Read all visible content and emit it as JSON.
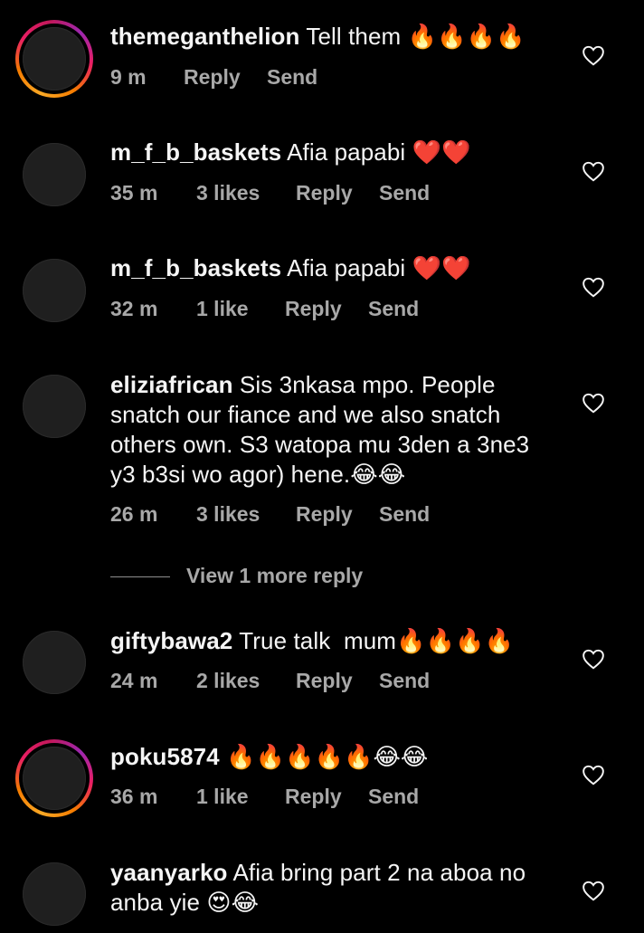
{
  "comments": [
    {
      "username": "themeganthelion",
      "text": "Tell them 🔥🔥🔥🔥",
      "time": "9 m",
      "likes": "",
      "reply": "Reply",
      "send": "Send",
      "story_ring": true
    },
    {
      "username": "m_f_b_baskets",
      "text": "Afia papabi ❤️❤️",
      "time": "35 m",
      "likes": "3 likes",
      "reply": "Reply",
      "send": "Send",
      "story_ring": false
    },
    {
      "username": "m_f_b_baskets",
      "text": "Afia papabi ❤️❤️",
      "time": "32 m",
      "likes": "1 like",
      "reply": "Reply",
      "send": "Send",
      "story_ring": false
    },
    {
      "username": "eliziafrican",
      "text": "Sis 3nkasa mpo. People snatch our fiance and we also snatch others own. S3 watopa mu 3den a 3ne3 y3 b3si wo agor) hene.😂😂",
      "time": "26 m",
      "likes": "3 likes",
      "reply": "Reply",
      "send": "Send",
      "story_ring": false
    },
    {
      "username": "giftybawa2",
      "text": "True talk  mum🔥🔥🔥🔥",
      "time": "24 m",
      "likes": "2 likes",
      "reply": "Reply",
      "send": "Send",
      "story_ring": false
    },
    {
      "username": "poku5874",
      "text": "🔥🔥🔥🔥🔥😂😂",
      "time": "36 m",
      "likes": "1 like",
      "reply": "Reply",
      "send": "Send",
      "story_ring": true
    },
    {
      "username": "yaanyarko",
      "text": "Afia bring part 2 na aboa no anba yie 😍😂",
      "time": "",
      "likes": "",
      "reply": "",
      "send": "",
      "story_ring": false
    }
  ],
  "view_more_replies": "View 1 more reply",
  "icons": {
    "like": "heart-outline-icon"
  },
  "colors": {
    "background": "#000000",
    "text": "#f5f5f5",
    "meta": "#a8a8a8",
    "ring_start": "#f9a825",
    "ring_end": "#c2185b"
  }
}
